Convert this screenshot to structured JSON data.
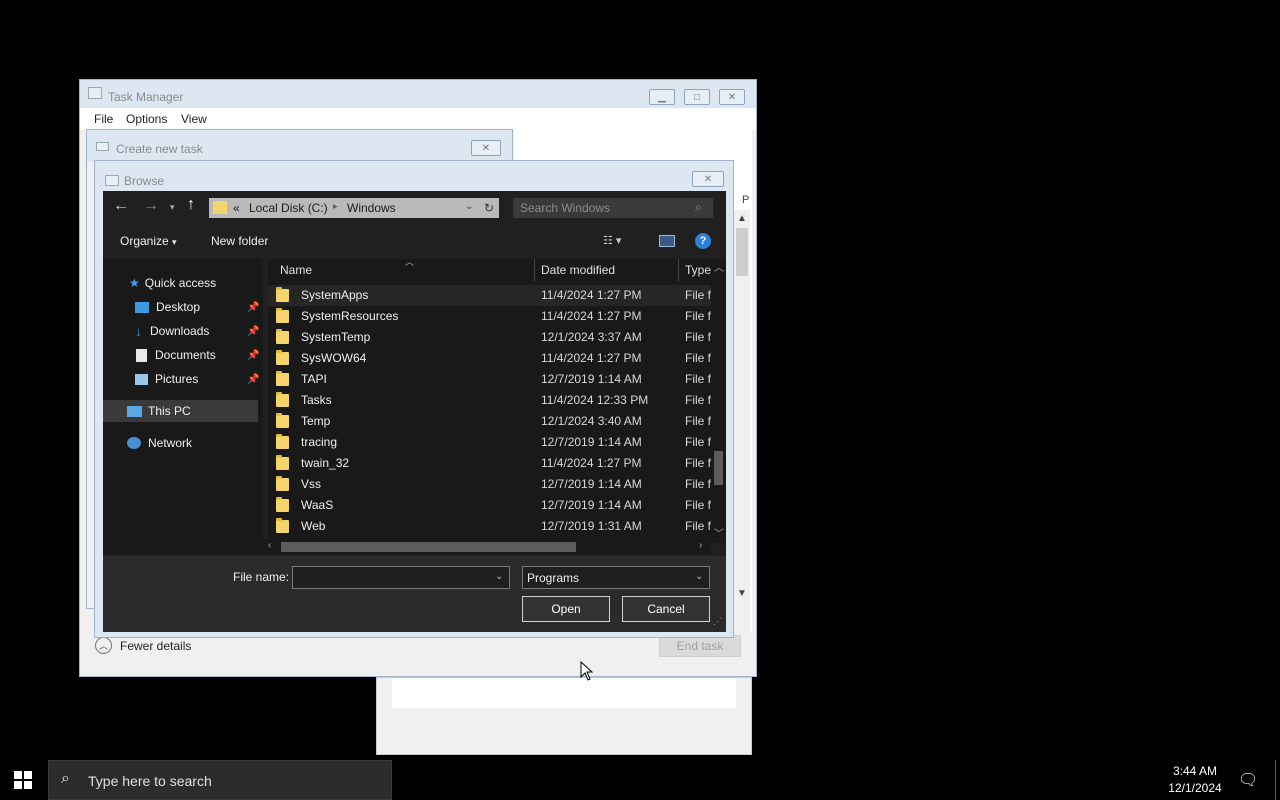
{
  "task_manager": {
    "title": "Task Manager",
    "menu": [
      "File",
      "Options",
      "View"
    ],
    "fewer_details": "Fewer details",
    "end_task": "End task",
    "col_letter": "P"
  },
  "create_task": {
    "title": "Create new task"
  },
  "browse": {
    "title": "Browse",
    "address": {
      "prefix": "«",
      "parts": [
        "Local Disk (C:)",
        "Windows"
      ]
    },
    "search_placeholder": "Search Windows",
    "toolbar": {
      "organize": "Organize",
      "new_folder": "New folder"
    },
    "nav": {
      "quick_access": "Quick access",
      "desktop": "Desktop",
      "downloads": "Downloads",
      "documents": "Documents",
      "pictures": "Pictures",
      "this_pc": "This PC",
      "network": "Network"
    },
    "columns": {
      "name": "Name",
      "date": "Date modified",
      "type": "Type"
    },
    "rows": [
      {
        "name": "SystemApps",
        "date": "11/4/2024 1:27 PM",
        "type": "File f"
      },
      {
        "name": "SystemResources",
        "date": "11/4/2024 1:27 PM",
        "type": "File f"
      },
      {
        "name": "SystemTemp",
        "date": "12/1/2024 3:37 AM",
        "type": "File f"
      },
      {
        "name": "SysWOW64",
        "date": "11/4/2024 1:27 PM",
        "type": "File f"
      },
      {
        "name": "TAPI",
        "date": "12/7/2019 1:14 AM",
        "type": "File f"
      },
      {
        "name": "Tasks",
        "date": "11/4/2024 12:33 PM",
        "type": "File f"
      },
      {
        "name": "Temp",
        "date": "12/1/2024 3:40 AM",
        "type": "File f"
      },
      {
        "name": "tracing",
        "date": "12/7/2019 1:14 AM",
        "type": "File f"
      },
      {
        "name": "twain_32",
        "date": "11/4/2024 1:27 PM",
        "type": "File f"
      },
      {
        "name": "Vss",
        "date": "12/7/2019 1:14 AM",
        "type": "File f"
      },
      {
        "name": "WaaS",
        "date": "12/7/2019 1:14 AM",
        "type": "File f"
      },
      {
        "name": "Web",
        "date": "12/7/2019 1:31 AM",
        "type": "File f"
      }
    ],
    "file_name_label": "File name:",
    "file_name_value": "",
    "file_type": "Programs",
    "open": "Open",
    "cancel": "Cancel"
  },
  "taskbar": {
    "search_placeholder": "Type here to search",
    "time": "3:44 AM",
    "date": "12/1/2024"
  }
}
